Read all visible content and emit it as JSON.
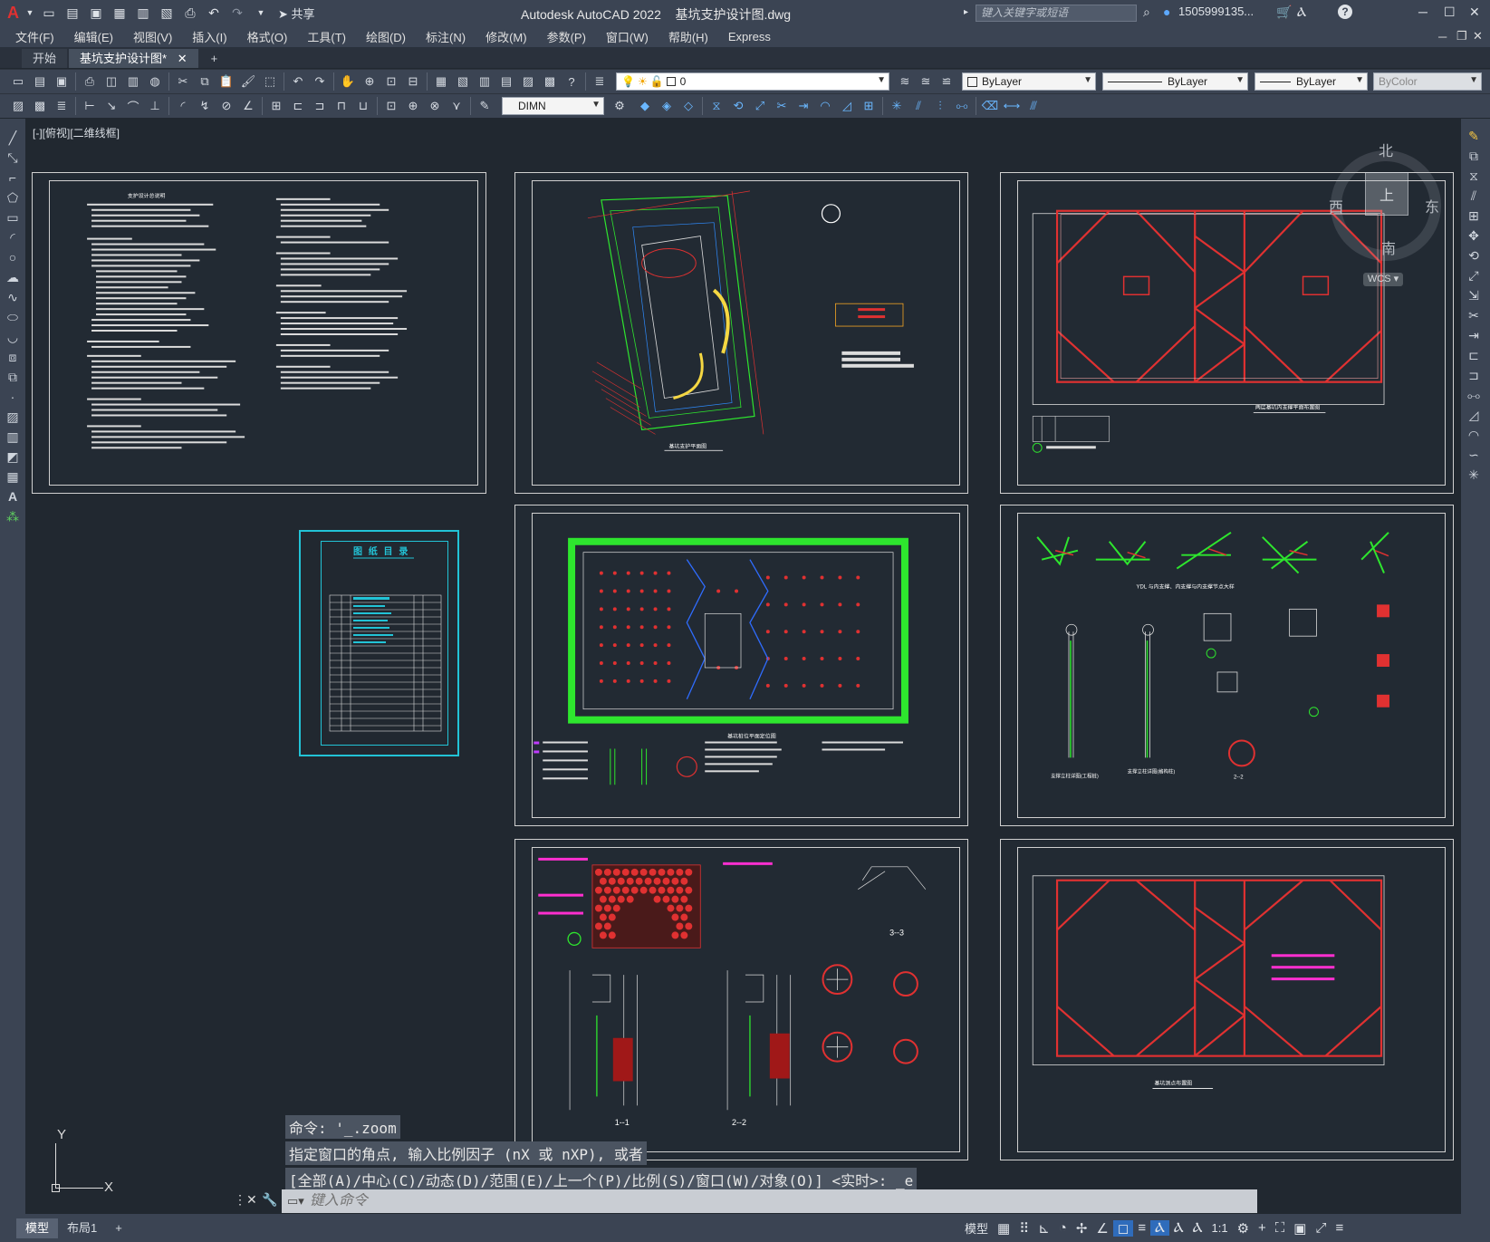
{
  "app": {
    "title": "Autodesk AutoCAD 2022    基坑支护设计图.dwg",
    "logo": "A",
    "share": "共享"
  },
  "search": {
    "placeholder": "键入关键字或短语",
    "user": "1505999135..."
  },
  "menu": [
    "文件(F)",
    "编辑(E)",
    "视图(V)",
    "插入(I)",
    "格式(O)",
    "工具(T)",
    "绘图(D)",
    "标注(N)",
    "修改(M)",
    "参数(P)",
    "窗口(W)",
    "帮助(H)",
    "Express"
  ],
  "tabs": [
    {
      "label": "开始"
    },
    {
      "label": "基坑支护设计图*"
    }
  ],
  "layers": {
    "current": "0",
    "color": "ByLayer",
    "linetype": "ByLayer",
    "lineweight": "ByLayer",
    "plotstyle": "ByColor"
  },
  "dimstyle": "DIMN",
  "viewport_label": "[-][俯视][二维线框]",
  "viewcube": {
    "north": "北",
    "south": "南",
    "east": "东",
    "west": "西",
    "top": "上",
    "wcs": "WCS"
  },
  "ucs": {
    "x": "X",
    "y": "Y"
  },
  "sheets": {
    "index_title": "图 纸 目 录",
    "plan_title": "基坑支护平面图",
    "support_title": "两层基坑内支撑平面布置图",
    "pile_title": "基坑桩位平面定位图",
    "detail_title": "YDL 与内支撑、内支撑与内支撑节点大样",
    "detail_a": "支撑立柱详图(工程桩)",
    "detail_b": "支撑立柱详图(格构柱)",
    "sec22": "2--2",
    "sec33": "3--3",
    "sec11": "1--1",
    "sec22b": "2--2",
    "monitor_title": "基坑测点布置图",
    "notes_title": "支护设计总说明"
  },
  "command": {
    "history": [
      "命令: '_.zoom",
      "指定窗口的角点, 输入比例因子 (nX 或 nXP), 或者",
      "[全部(A)/中心(C)/动态(D)/范围(E)/上一个(P)/比例(S)/窗口(W)/对象(O)] <实时>: _e"
    ],
    "placeholder": "键入命令"
  },
  "status": {
    "tabs": [
      "模型",
      "布局1"
    ],
    "mode": "模型",
    "scale": "1:1"
  }
}
